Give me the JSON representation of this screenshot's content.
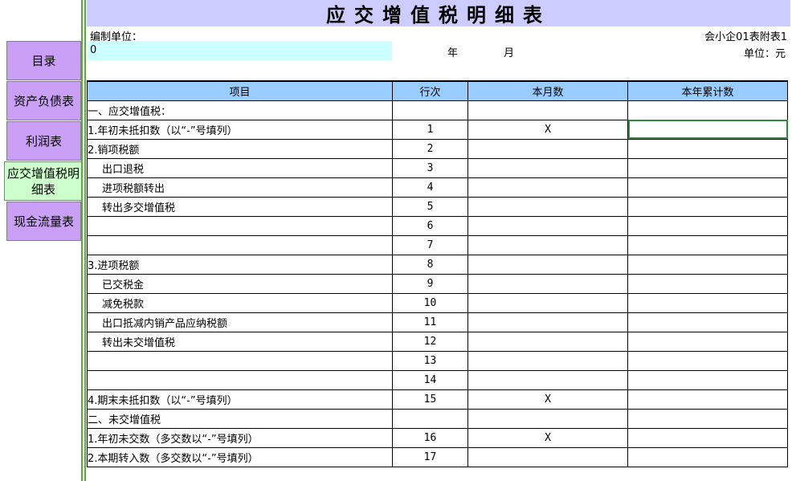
{
  "sidebar": {
    "items": [
      {
        "label": "目录"
      },
      {
        "label": "资产负债表"
      },
      {
        "label": "利润表"
      },
      {
        "label": "应交增值税明细表"
      },
      {
        "label": "现金流量表"
      }
    ]
  },
  "header": {
    "title": "应交增值税明细表",
    "unit_label": "编制单位：",
    "unit_value": "0",
    "year_label": "年",
    "month_label": "月",
    "form_code": "会小企01表附表1",
    "currency": "单位：元"
  },
  "table": {
    "columns": [
      "项目",
      "行次",
      "本月数",
      "本年累计数"
    ],
    "rows": [
      {
        "item": "一、应交增值税：",
        "num": "",
        "month": "",
        "year": ""
      },
      {
        "item": "1.年初未抵扣数（以“-”号填列）",
        "num": "1",
        "month": "X",
        "year": ""
      },
      {
        "item": "2.销项税额",
        "num": "2",
        "month": "",
        "year": ""
      },
      {
        "item": "出口退税",
        "num": "3",
        "month": "",
        "year": ""
      },
      {
        "item": "进项税额转出",
        "num": "4",
        "month": "",
        "year": ""
      },
      {
        "item": "转出多交增值税",
        "num": "5",
        "month": "",
        "year": ""
      },
      {
        "item": "",
        "num": "6",
        "month": "",
        "year": ""
      },
      {
        "item": "",
        "num": "7",
        "month": "",
        "year": ""
      },
      {
        "item": "3.进项税额",
        "num": "8",
        "month": "",
        "year": ""
      },
      {
        "item": "已交税金",
        "num": "9",
        "month": "",
        "year": ""
      },
      {
        "item": "减免税款",
        "num": "10",
        "month": "",
        "year": ""
      },
      {
        "item": "出口抵减内销产品应纳税额",
        "num": "11",
        "month": "",
        "year": ""
      },
      {
        "item": "转出未交增值税",
        "num": "12",
        "month": "",
        "year": ""
      },
      {
        "item": "",
        "num": "13",
        "month": "",
        "year": ""
      },
      {
        "item": "",
        "num": "14",
        "month": "",
        "year": ""
      },
      {
        "item": "4.期末未抵扣数（以“-”号填列）",
        "num": "15",
        "month": "X",
        "year": ""
      },
      {
        "item": "二、未交增值税",
        "num": "",
        "month": "",
        "year": ""
      },
      {
        "item": "1.年初未交数（多交数以“-”号填列）",
        "num": "16",
        "month": "X",
        "year": ""
      },
      {
        "item": "2.本期转入数（多交数以“-”号填列）",
        "num": "17",
        "month": "",
        "year": ""
      }
    ]
  }
}
